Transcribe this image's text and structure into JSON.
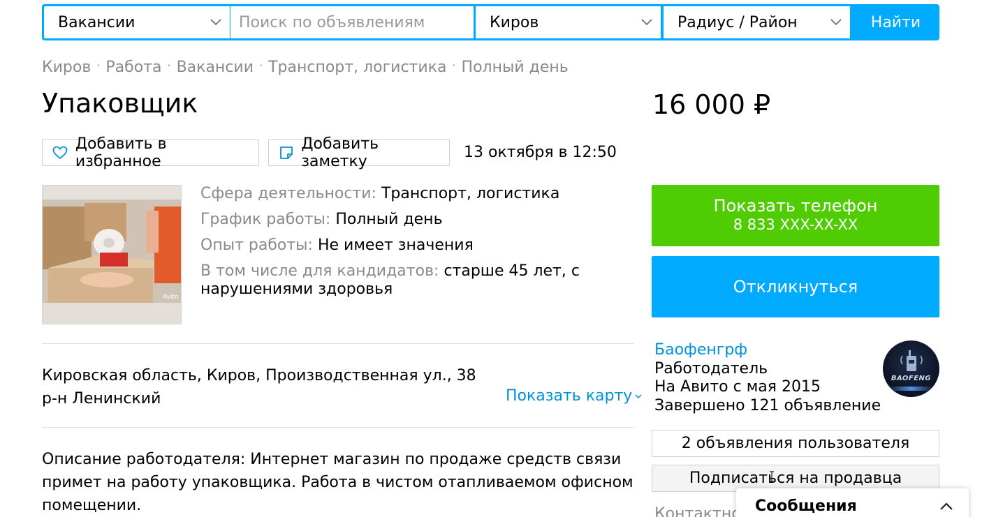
{
  "search": {
    "category": "Вакансии",
    "query_placeholder": "Поиск по объявлениям",
    "city": "Киров",
    "radius": "Радиус / Район",
    "submit_label": "Найти"
  },
  "breadcrumbs": [
    "Киров",
    "Работа",
    "Вакансии",
    "Транспорт, логистика",
    "Полный день"
  ],
  "listing": {
    "title": "Упаковщик",
    "price": "16 000 ₽",
    "favorite_label": "Добавить в избранное",
    "note_label": "Добавить заметку",
    "date": "13 октября в 12:50",
    "params": [
      {
        "label": "Сфера деятельности:",
        "value": "Транспорт, логистика"
      },
      {
        "label": "График работы:",
        "value": "Полный день"
      },
      {
        "label": "Опыт работы:",
        "value": "Не имеет значения"
      },
      {
        "label": "В том числе для кандидатов:",
        "value": "старше 45 лет, с нарушениями здоровья"
      }
    ],
    "photo_watermark": "Avito",
    "address_line1": "Кировская область, Киров, Производственная ул., 38",
    "address_line2": "р-н Ленинский",
    "show_map_label": "Показать карту",
    "description": "Описание работодателя: Интернет магазин по продаже средств связи примет на работу упаковщика. Работа в чистом отапливаемом офисном помещении."
  },
  "sidebar": {
    "phone_button_label": "Показать телефон",
    "phone_masked": "8 833 XXX-XX-XX",
    "reply_button_label": "Откликнуться",
    "seller_name": "Баофенгрф",
    "seller_role": "Работодатель",
    "seller_since": "На Авито с мая 2015",
    "seller_completed": "Завершено 121 объявление",
    "avatar_brand": "BAOFENG",
    "ads_button_label": "2 объявления пользователя",
    "subscribe_button_label": "Подписаться на продавца",
    "contact_peek": "Контактное"
  },
  "messages": {
    "title": "Сообщения"
  },
  "colors": {
    "accent_blue": "#00aaff",
    "link_blue": "#0091d9",
    "phone_green": "#4fcc04",
    "muted_gray": "#8a8a8a"
  }
}
